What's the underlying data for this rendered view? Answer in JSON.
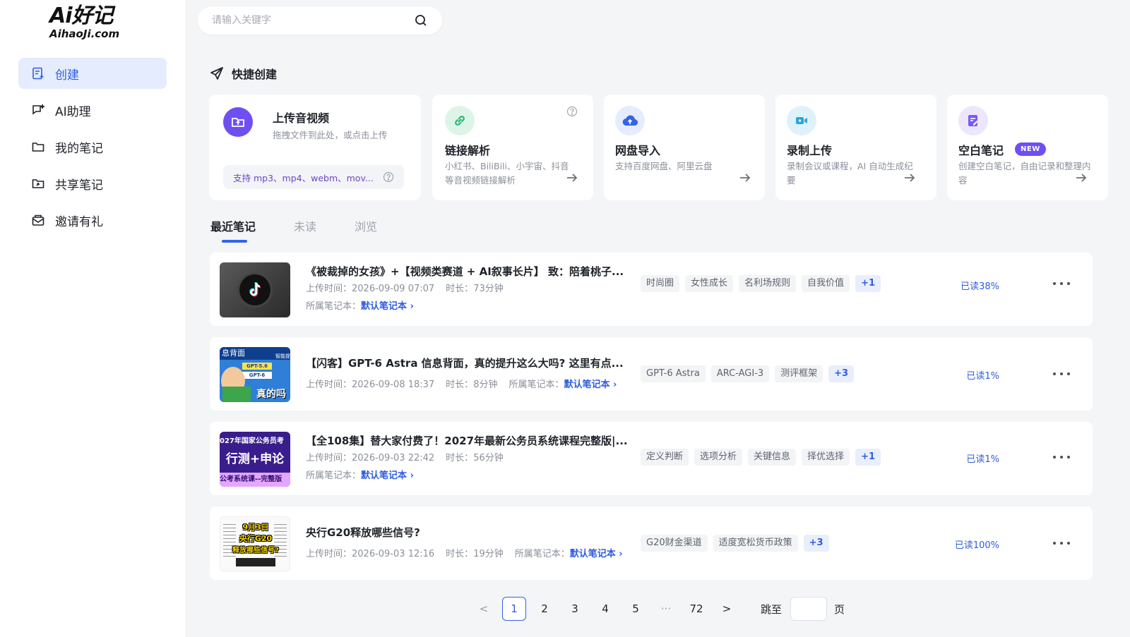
{
  "logo": {
    "top": "Ai好记",
    "bottom": "AihaoJi.com"
  },
  "sidebar": {
    "items": [
      {
        "label": "创建",
        "icon": "create-note-icon",
        "active": true
      },
      {
        "label": "AI助理",
        "icon": "ai-assistant-icon",
        "active": false
      },
      {
        "label": "我的笔记",
        "icon": "folder-icon",
        "active": false
      },
      {
        "label": "共享笔记",
        "icon": "shared-folder-icon",
        "active": false
      },
      {
        "label": "邀请有礼",
        "icon": "gift-mail-icon",
        "active": false
      }
    ]
  },
  "search": {
    "placeholder": "请输入关键字",
    "value": ""
  },
  "quick_create": {
    "title": "快捷创建",
    "upload": {
      "title": "上传音视频",
      "desc": "拖拽文件到此处，或点击上传",
      "formats": "支持 mp3、mp4、webm、mov..."
    },
    "link": {
      "title": "链接解析",
      "desc": "小红书、BiliBili、小宇宙、抖音等音视频链接解析"
    },
    "cloud": {
      "title": "网盘导入",
      "desc": "支持百度网盘、阿里云盘"
    },
    "record": {
      "title": "录制上传",
      "desc": "录制会议或课程，AI 自动生成纪要"
    },
    "blank": {
      "title": "空白笔记",
      "badge": "NEW",
      "desc": "创建空白笔记，自由记录和整理内容"
    }
  },
  "tabs": [
    "最近笔记",
    "未读",
    "浏览"
  ],
  "notes": [
    {
      "title": "《被裁掉的女孩》+【视频类赛道 + AI叙事长片】 致：陪着桃子...",
      "upload_label": "上传时间：",
      "upload_time": "2026-09-09 07:07",
      "duration_label": "时长：",
      "duration": "73分钟",
      "notebook_label": "所属笔记本：",
      "notebook": "默认笔记本",
      "tags": [
        "时尚圈",
        "女性成长",
        "名利场规则",
        "自我价值"
      ],
      "more": "+1",
      "read": "已读38%"
    },
    {
      "title": "【闪客】GPT-6 Astra 信息背面，真的提升这么大吗? 这里有点...",
      "upload_label": "上传时间：",
      "upload_time": "2026-09-08 18:37",
      "duration_label": "时长：",
      "duration": "8分钟",
      "notebook_label": "所属笔记本：",
      "notebook": "默认笔记本",
      "tags": [
        "GPT-6 Astra",
        "ARC-AGI-3",
        "测评框架"
      ],
      "more": "+3",
      "read": "已读1%",
      "thumb_text": [
        "息背面",
        "GPT-5.6",
        "GPT-6",
        "智能提",
        "真的吗"
      ]
    },
    {
      "title": "【全108集】替大家付费了！2027年最新公务员系统课程完整版|...",
      "upload_label": "上传时间：",
      "upload_time": "2026-09-03 22:42",
      "duration_label": "时长：",
      "duration": "56分钟",
      "notebook_label": "所属笔记本：",
      "notebook": "默认笔记本",
      "tags": [
        "定义判断",
        "选项分析",
        "关键信息",
        "择优选择"
      ],
      "more": "+1",
      "read": "已读1%",
      "thumb_text": [
        "027年国家公务员考",
        "行测+申论",
        "公考系统课--完整版"
      ]
    },
    {
      "title": "央行G20释放哪些信号?",
      "upload_label": "上传时间：",
      "upload_time": "2026-09-03 12:16",
      "duration_label": "时长：",
      "duration": "19分钟",
      "notebook_label": "所属笔记本：",
      "notebook": "默认笔记本",
      "tags": [
        "G20财金渠道",
        "适度宽松货币政策"
      ],
      "more": "+3",
      "read": "已读100%",
      "thumb_text": [
        "9月3日",
        "央行G20",
        "释放哪些信号?"
      ]
    }
  ],
  "pagination": {
    "prev": "<",
    "pages": [
      "1",
      "2",
      "3",
      "4",
      "5"
    ],
    "ellipsis": "···",
    "last": "72",
    "next": ">",
    "current": "1",
    "jump_label": "跳至",
    "page_unit": "页"
  },
  "colors": {
    "accent": "#3363e8",
    "purple": "#6f4ff2",
    "green": "#2bb673",
    "sidebar_active_bg": "#e4ecfe"
  }
}
